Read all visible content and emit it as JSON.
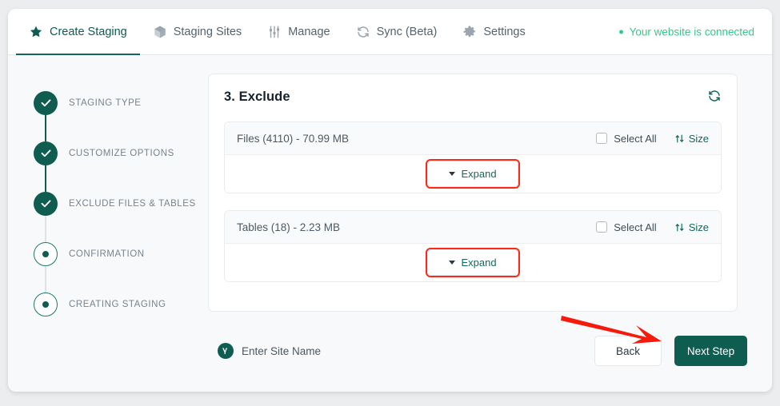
{
  "nav": {
    "tabs": [
      {
        "label": "Create Staging",
        "icon": "star-icon",
        "active": true
      },
      {
        "label": "Staging Sites",
        "icon": "cube-icon",
        "active": false
      },
      {
        "label": "Manage",
        "icon": "sliders-icon",
        "active": false
      },
      {
        "label": "Sync (Beta)",
        "icon": "sync-icon",
        "active": false
      },
      {
        "label": "Settings",
        "icon": "gear-icon",
        "active": false
      }
    ],
    "connection_status": "Your website is connected",
    "connection_color": "#35c98b"
  },
  "stepper": {
    "steps": [
      {
        "label": "STAGING TYPE",
        "state": "done"
      },
      {
        "label": "CUSTOMIZE OPTIONS",
        "state": "done"
      },
      {
        "label": "EXCLUDE FILES & TABLES",
        "state": "done"
      },
      {
        "label": "CONFIRMATION",
        "state": "todo"
      },
      {
        "label": "CREATING STAGING",
        "state": "todo"
      }
    ]
  },
  "panel": {
    "title": "3. Exclude",
    "refresh_icon": "refresh-icon",
    "groups": [
      {
        "title": "Files (4110) - 70.99 MB",
        "select_all_label": "Select All",
        "select_all_checked": false,
        "sort_label": "Size",
        "sort_icon": "sort-updown-icon",
        "expand_label": "Expand",
        "expand_highlighted": true
      },
      {
        "title": "Tables (18) - 2.23 MB",
        "select_all_label": "Select All",
        "select_all_checked": false,
        "sort_label": "Size",
        "sort_icon": "sort-updown-icon",
        "expand_label": "Expand",
        "expand_highlighted": true
      }
    ]
  },
  "footer": {
    "site_name_label": "Enter Site Name",
    "site_name_icon": "wp-staging-badge-icon",
    "back_label": "Back",
    "next_label": "Next Step",
    "next_color": "#0f5c50"
  },
  "annotation": {
    "arrow_color": "#f41b0c",
    "points_to": "Next Step"
  }
}
